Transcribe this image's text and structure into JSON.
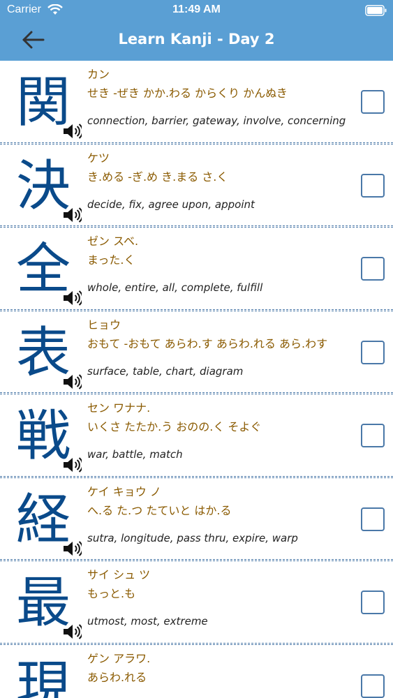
{
  "status_bar": {
    "carrier": "Carrier",
    "time": "11:49 AM"
  },
  "nav": {
    "title": "Learn Kanji - Day 2",
    "back_icon": "arrow-left-icon"
  },
  "colors": {
    "header": "#5a9fd4",
    "kanji": "#0a4a8a",
    "reading": "#8a5a00",
    "divider": "#4a78a8"
  },
  "kanji_list": [
    {
      "kanji": "関",
      "on": "カン",
      "kun": "せき -ぜき かか.わる からくり かんぬき",
      "meaning": "connection, barrier, gateway, involve, concerning",
      "checked": false
    },
    {
      "kanji": "決",
      "on": "ケツ",
      "kun": "き.める -ぎ.め き.まる さ.く",
      "meaning": "decide, fix, agree upon, appoint",
      "checked": false
    },
    {
      "kanji": "全",
      "on": "ゼン スベ.",
      "kun": "まった.く",
      "meaning": "whole, entire, all, complete, fulfill",
      "checked": false
    },
    {
      "kanji": "表",
      "on": "ヒョウ",
      "kun": "おもて -おもて あらわ.す あらわ.れる あら.わす",
      "meaning": "surface, table, chart, diagram",
      "checked": false
    },
    {
      "kanji": "戦",
      "on": "セン ワナナ.",
      "kun": "いくさ たたか.う おのの.く そよぐ",
      "meaning": "war, battle, match",
      "checked": false
    },
    {
      "kanji": "経",
      "on": "ケイ キョウ ノ",
      "kun": "へ.る た.つ たていと はか.る",
      "meaning": "sutra, longitude, pass thru, expire, warp",
      "checked": false
    },
    {
      "kanji": "最",
      "on": "サイ シュ ツ",
      "kun": "もっと.も",
      "meaning": "utmost, most, extreme",
      "checked": false
    },
    {
      "kanji": "現",
      "on": "ゲン アラワ.",
      "kun": "あらわ.れる",
      "meaning": "",
      "checked": false
    }
  ]
}
